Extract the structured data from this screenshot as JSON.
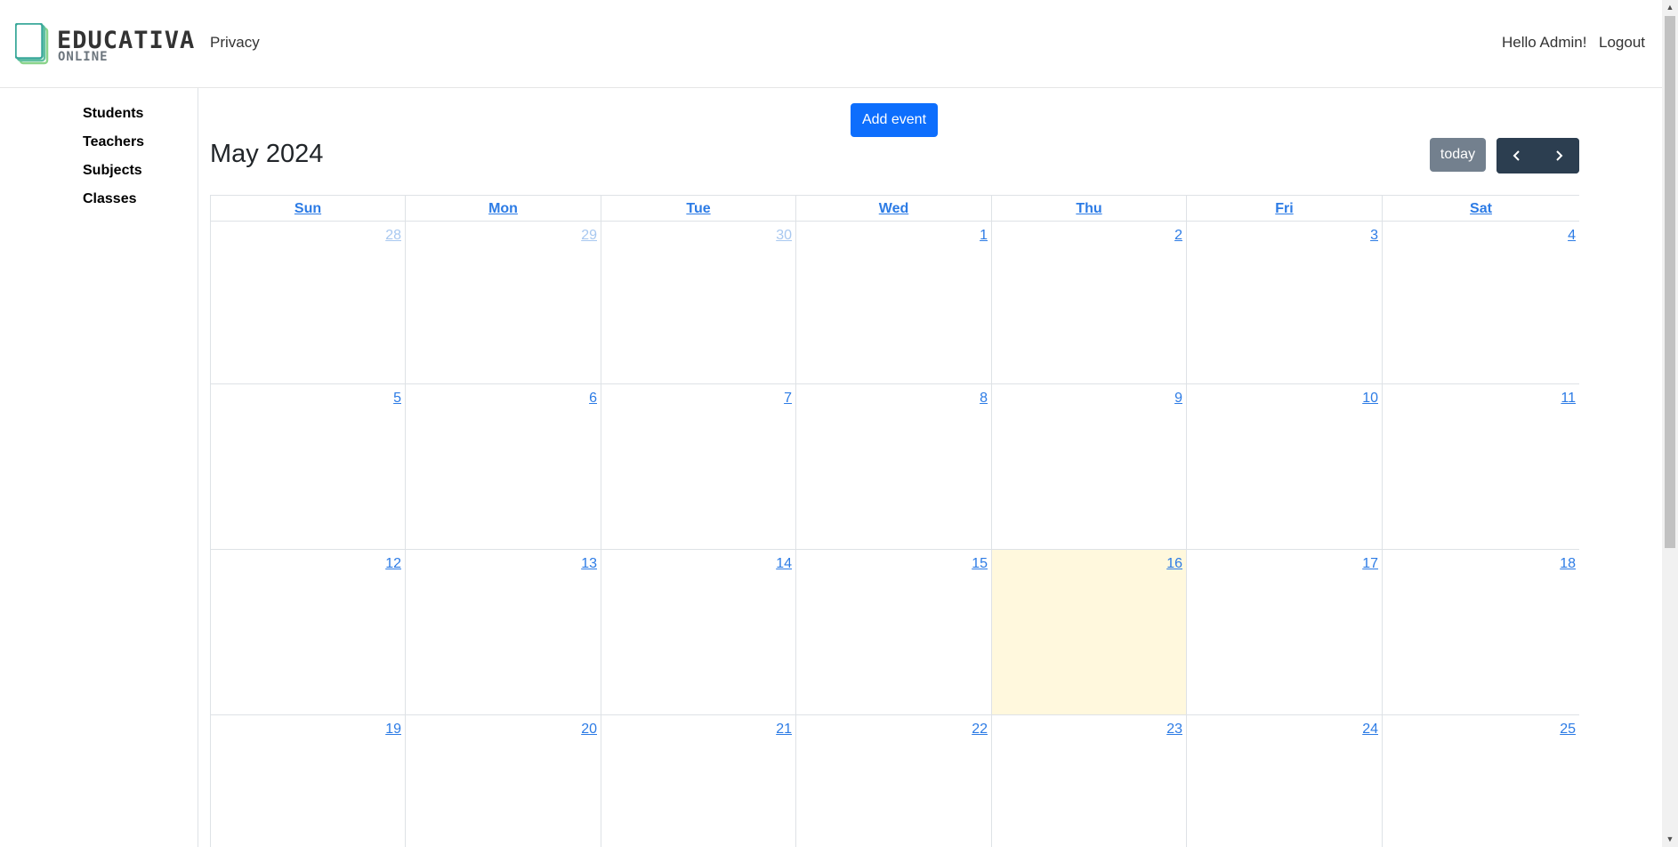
{
  "header": {
    "logo_title": "EDUCATIVA",
    "logo_subtitle": "ONLINE",
    "nav_privacy": "Privacy",
    "greeting": "Hello Admin!",
    "logout": "Logout"
  },
  "sidebar": {
    "items": [
      {
        "label": "Students"
      },
      {
        "label": "Teachers"
      },
      {
        "label": "Subjects"
      },
      {
        "label": "Classes"
      }
    ]
  },
  "toolbar": {
    "add_event": "Add event",
    "title": "May 2024",
    "today": "today",
    "prev_icon": "chevron-left-icon",
    "next_icon": "chevron-right-icon"
  },
  "calendar": {
    "weekdays": [
      "Sun",
      "Mon",
      "Tue",
      "Wed",
      "Thu",
      "Fri",
      "Sat"
    ],
    "today_date": "16",
    "weeks": [
      [
        {
          "d": "28",
          "other": true
        },
        {
          "d": "29",
          "other": true
        },
        {
          "d": "30",
          "other": true
        },
        {
          "d": "1"
        },
        {
          "d": "2"
        },
        {
          "d": "3"
        },
        {
          "d": "4"
        }
      ],
      [
        {
          "d": "5"
        },
        {
          "d": "6"
        },
        {
          "d": "7"
        },
        {
          "d": "8"
        },
        {
          "d": "9"
        },
        {
          "d": "10"
        },
        {
          "d": "11"
        }
      ],
      [
        {
          "d": "12"
        },
        {
          "d": "13"
        },
        {
          "d": "14"
        },
        {
          "d": "15"
        },
        {
          "d": "16",
          "today": true
        },
        {
          "d": "17"
        },
        {
          "d": "18"
        }
      ],
      [
        {
          "d": "19"
        },
        {
          "d": "20"
        },
        {
          "d": "21"
        },
        {
          "d": "22"
        },
        {
          "d": "23"
        },
        {
          "d": "24"
        },
        {
          "d": "25"
        }
      ]
    ]
  },
  "colors": {
    "primary": "#0d6efd",
    "link": "#2c7be5",
    "today_bg": "#fff8dd",
    "nav_dark": "#2c3e50",
    "today_btn": "#6c7a89"
  }
}
